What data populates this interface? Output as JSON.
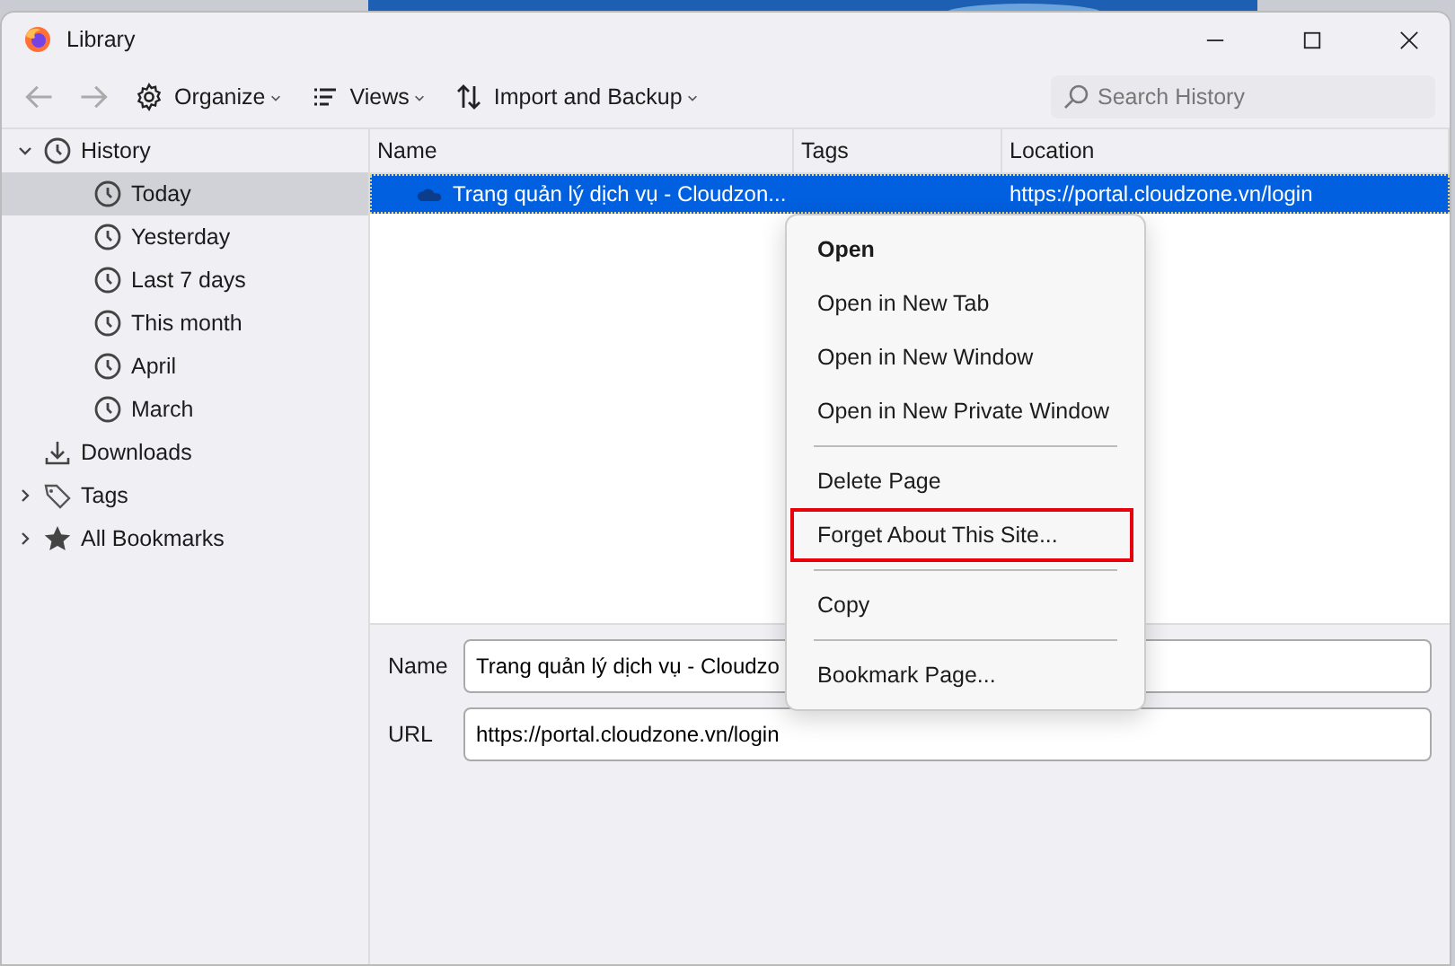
{
  "window": {
    "title": "Library"
  },
  "toolbar": {
    "buttons": [
      {
        "label": "Organize"
      },
      {
        "label": "Views"
      },
      {
        "label": "Import and Backup"
      }
    ],
    "search": {
      "placeholder": "Search History"
    }
  },
  "sidebar": {
    "items": [
      {
        "kind": "history",
        "label": "History",
        "expanded": true,
        "selected": false,
        "children": [
          {
            "kind": "period",
            "label": "Today",
            "selected": true
          },
          {
            "kind": "period",
            "label": "Yesterday",
            "selected": false
          },
          {
            "kind": "period",
            "label": "Last 7 days",
            "selected": false
          },
          {
            "kind": "period",
            "label": "This month",
            "selected": false
          },
          {
            "kind": "period",
            "label": "April",
            "selected": false
          },
          {
            "kind": "period",
            "label": "March",
            "selected": false
          }
        ]
      },
      {
        "kind": "downloads",
        "label": "Downloads",
        "selected": false
      },
      {
        "kind": "tags",
        "label": "Tags",
        "expanded": false,
        "selected": false
      },
      {
        "kind": "bookmarks",
        "label": "All Bookmarks",
        "expanded": false,
        "selected": false
      }
    ]
  },
  "table": {
    "columns": [
      "Name",
      "Tags",
      "Location"
    ],
    "rows": [
      {
        "name": "Trang quản lý dịch vụ - Cloudzon...",
        "location": "https://portal.cloudzone.vn/login",
        "selected": true
      }
    ]
  },
  "details": {
    "fields": [
      {
        "label": "Name",
        "value": "Trang quản lý dịch vụ - Cloudzo"
      },
      {
        "label": "URL",
        "value": "https://portal.cloudzone.vn/login"
      }
    ]
  },
  "context_menu": {
    "items": [
      {
        "kind": "item",
        "label": "Open",
        "bold": true,
        "highlighted": false
      },
      {
        "kind": "item",
        "label": "Open in New Tab",
        "bold": false,
        "highlighted": false
      },
      {
        "kind": "item",
        "label": "Open in New Window",
        "bold": false,
        "highlighted": false
      },
      {
        "kind": "item",
        "label": "Open in New Private Window",
        "bold": false,
        "highlighted": false
      },
      {
        "kind": "separator"
      },
      {
        "kind": "item",
        "label": "Delete Page",
        "bold": false,
        "highlighted": false
      },
      {
        "kind": "item",
        "label": "Forget About This Site...",
        "bold": false,
        "highlighted": true
      },
      {
        "kind": "separator"
      },
      {
        "kind": "item",
        "label": "Copy",
        "bold": false,
        "highlighted": false
      },
      {
        "kind": "separator"
      },
      {
        "kind": "item",
        "label": "Bookmark Page...",
        "bold": false,
        "highlighted": false
      }
    ]
  }
}
